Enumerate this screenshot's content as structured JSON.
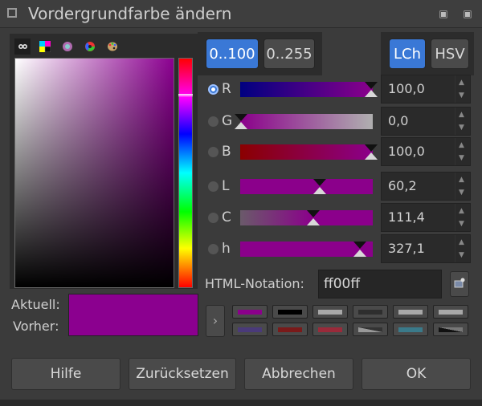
{
  "window": {
    "title": "Vordergrundfarbe ändern"
  },
  "selector_tabs": [
    "gimp-icon",
    "cmyk-icon",
    "watercolor-icon",
    "wheel-icon",
    "palette-icon"
  ],
  "range_buttons": [
    {
      "label": "0..100",
      "active": true
    },
    {
      "label": "0..255",
      "active": false
    }
  ],
  "model_buttons": [
    {
      "label": "LCh",
      "active": true
    },
    {
      "label": "HSV",
      "active": false
    }
  ],
  "channels": [
    {
      "label": "R",
      "value": "100,0",
      "selected": true
    },
    {
      "label": "G",
      "value": "0,0",
      "selected": false
    },
    {
      "label": "B",
      "value": "100,0",
      "selected": false
    },
    {
      "label": "L",
      "value": "60,2",
      "selected": false
    },
    {
      "label": "C",
      "value": "111,4",
      "selected": false
    },
    {
      "label": "h",
      "value": "327,1",
      "selected": false
    }
  ],
  "html_notation": {
    "label": "HTML-Notation:",
    "value": "ff00ff"
  },
  "swatch": {
    "current_label": "Aktuell:",
    "previous_label": "Vorher:",
    "current_color": "#8b008f"
  },
  "buttons": {
    "help": "Hilfe",
    "reset": "Zurücksetzen",
    "cancel": "Abbrechen",
    "ok": "OK"
  },
  "colors": {
    "accent": "#3a78d6"
  }
}
